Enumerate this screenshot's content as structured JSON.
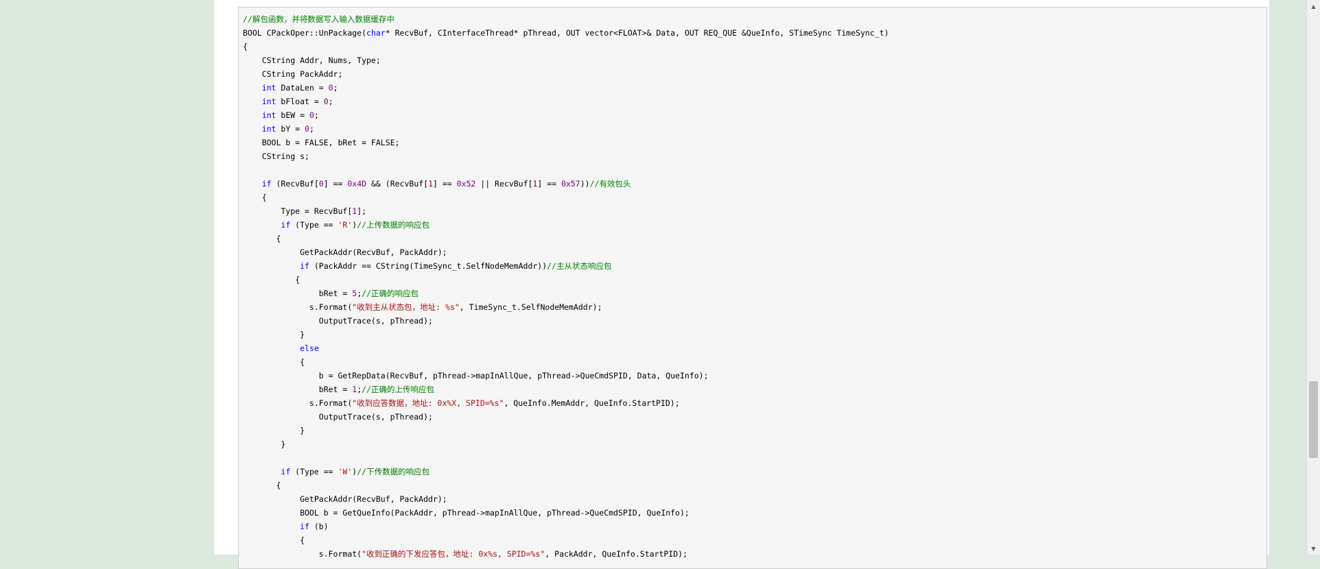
{
  "code": {
    "lines": [
      [
        {
          "t": "//解包函数，并将数据写入输入数据缓存中",
          "c": "cm"
        }
      ],
      [
        {
          "t": "BOOL CPackOper::UnPackage("
        },
        {
          "t": "char",
          "c": "kw"
        },
        {
          "t": "* RecvBuf, CInterfaceThread* pThread, OUT vector<FLOAT>& Data, OUT REQ_QUE &QueInfo, STimeSync TimeSync_t)"
        }
      ],
      [
        {
          "t": "{"
        }
      ],
      [
        {
          "t": "    CString Addr, Nums, Type;"
        }
      ],
      [
        {
          "t": "    CString PackAddr;"
        }
      ],
      [
        {
          "t": "    "
        },
        {
          "t": "int",
          "c": "kw"
        },
        {
          "t": " DataLen = "
        },
        {
          "t": "0",
          "c": "num"
        },
        {
          "t": ";"
        }
      ],
      [
        {
          "t": "    "
        },
        {
          "t": "int",
          "c": "kw"
        },
        {
          "t": " bFloat = "
        },
        {
          "t": "0",
          "c": "num"
        },
        {
          "t": ";"
        }
      ],
      [
        {
          "t": "    "
        },
        {
          "t": "int",
          "c": "kw"
        },
        {
          "t": " bEW = "
        },
        {
          "t": "0",
          "c": "num"
        },
        {
          "t": ";"
        }
      ],
      [
        {
          "t": "    "
        },
        {
          "t": "int",
          "c": "kw"
        },
        {
          "t": " bY = "
        },
        {
          "t": "0",
          "c": "num"
        },
        {
          "t": ";"
        }
      ],
      [
        {
          "t": "    BOOL b = FALSE, bRet = FALSE;"
        }
      ],
      [
        {
          "t": "    CString s;"
        }
      ],
      [],
      [
        {
          "t": "    "
        },
        {
          "t": "if",
          "c": "kw"
        },
        {
          "t": " (RecvBuf["
        },
        {
          "t": "0",
          "c": "num"
        },
        {
          "t": "] == "
        },
        {
          "t": "0x4D",
          "c": "num"
        },
        {
          "t": " && (RecvBuf["
        },
        {
          "t": "1",
          "c": "num"
        },
        {
          "t": "] == "
        },
        {
          "t": "0x52",
          "c": "num"
        },
        {
          "t": " || RecvBuf["
        },
        {
          "t": "1",
          "c": "num"
        },
        {
          "t": "] == "
        },
        {
          "t": "0x57",
          "c": "num"
        },
        {
          "t": "))"
        },
        {
          "t": "//有效包头",
          "c": "cm"
        }
      ],
      [
        {
          "t": "    {"
        }
      ],
      [
        {
          "t": "        Type = RecvBuf["
        },
        {
          "t": "1",
          "c": "num"
        },
        {
          "t": "];"
        }
      ],
      [
        {
          "t": "        "
        },
        {
          "t": "if",
          "c": "kw"
        },
        {
          "t": " (Type == "
        },
        {
          "t": "'R'",
          "c": "str"
        },
        {
          "t": ")"
        },
        {
          "t": "//上传数据的响应包",
          "c": "cm"
        }
      ],
      [
        {
          "t": "       {"
        }
      ],
      [
        {
          "t": "            GetPackAddr(RecvBuf, PackAddr);"
        }
      ],
      [
        {
          "t": "            "
        },
        {
          "t": "if",
          "c": "kw"
        },
        {
          "t": " (PackAddr == CString(TimeSync_t.SelfNodeMemAddr))"
        },
        {
          "t": "//主从状态响应包",
          "c": "cm"
        }
      ],
      [
        {
          "t": "           {"
        }
      ],
      [
        {
          "t": "                bRet = "
        },
        {
          "t": "5",
          "c": "num"
        },
        {
          "t": ";"
        },
        {
          "t": "//正确的响应包",
          "c": "cm"
        }
      ],
      [
        {
          "t": "              s.Format("
        },
        {
          "t": "\"收到主从状态包，地址: %s\"",
          "c": "str"
        },
        {
          "t": ", TimeSync_t.SelfNodeMemAddr);"
        }
      ],
      [
        {
          "t": "                OutputTrace(s, pThread);"
        }
      ],
      [
        {
          "t": "            }"
        }
      ],
      [
        {
          "t": "            "
        },
        {
          "t": "else",
          "c": "kw"
        }
      ],
      [
        {
          "t": "            {"
        }
      ],
      [
        {
          "t": "                b = GetRepData(RecvBuf, pThread->mapInAllQue, pThread->QueCmdSPID, Data, QueInfo);"
        }
      ],
      [
        {
          "t": "                bRet = "
        },
        {
          "t": "1",
          "c": "num"
        },
        {
          "t": ";"
        },
        {
          "t": "//正确的上传响应包",
          "c": "cm"
        }
      ],
      [
        {
          "t": "              s.Format("
        },
        {
          "t": "\"收到应答数据，地址: 0x%X, SPID=%s\"",
          "c": "str"
        },
        {
          "t": ", QueInfo.MemAddr, QueInfo.StartPID);"
        }
      ],
      [
        {
          "t": "                OutputTrace(s, pThread);"
        }
      ],
      [
        {
          "t": "            }"
        }
      ],
      [
        {
          "t": "        }"
        }
      ],
      [],
      [
        {
          "t": "        "
        },
        {
          "t": "if",
          "c": "kw"
        },
        {
          "t": " (Type == "
        },
        {
          "t": "'W'",
          "c": "str"
        },
        {
          "t": ")"
        },
        {
          "t": "//下传数据的响应包",
          "c": "cm"
        }
      ],
      [
        {
          "t": "       {"
        }
      ],
      [
        {
          "t": "            GetPackAddr(RecvBuf, PackAddr);"
        }
      ],
      [
        {
          "t": "            BOOL b = GetQueInfo(PackAddr, pThread->mapInAllQue, pThread->QueCmdSPID, QueInfo);"
        }
      ],
      [
        {
          "t": "            "
        },
        {
          "t": "if",
          "c": "kw"
        },
        {
          "t": " (b)"
        }
      ],
      [
        {
          "t": "            {"
        }
      ],
      [
        {
          "t": "                s.Format("
        },
        {
          "t": "\"收到正确的下发应答包，地址: 0x%s, SPID=%s\"",
          "c": "str"
        },
        {
          "t": ", PackAddr, QueInfo.StartPID);"
        }
      ]
    ]
  },
  "scrollbar": {
    "up_icon": "▲",
    "down_icon": "▼"
  }
}
